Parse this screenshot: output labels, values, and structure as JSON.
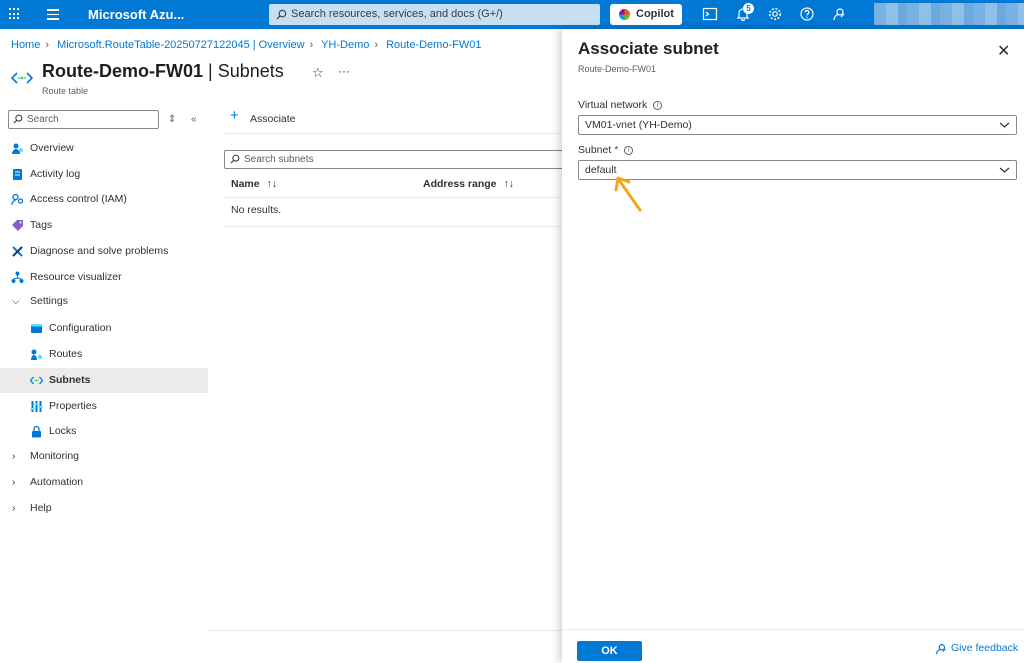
{
  "topbar": {
    "brand": "Microsoft Azu...",
    "search_placeholder": "Search resources, services, and docs (G+/)",
    "copilot_label": "Copilot",
    "notification_count": "5"
  },
  "breadcrumb": [
    "Home",
    "Microsoft.RouteTable-20250727122045 | Overview",
    "YH-Demo",
    "Route-Demo-FW01"
  ],
  "header": {
    "title": "Route-Demo-FW01",
    "section": "Subnets",
    "resource_type": "Route table"
  },
  "sidebar": {
    "search_placeholder": "Search",
    "items": [
      {
        "label": "Overview"
      },
      {
        "label": "Activity log"
      },
      {
        "label": "Access control (IAM)"
      },
      {
        "label": "Tags"
      },
      {
        "label": "Diagnose and solve problems"
      },
      {
        "label": "Resource visualizer"
      },
      {
        "label": "Settings"
      },
      {
        "label": "Configuration"
      },
      {
        "label": "Routes"
      },
      {
        "label": "Subnets"
      },
      {
        "label": "Properties"
      },
      {
        "label": "Locks"
      },
      {
        "label": "Monitoring"
      },
      {
        "label": "Automation"
      },
      {
        "label": "Help"
      }
    ]
  },
  "main": {
    "associate_label": "Associate",
    "search_placeholder": "Search subnets",
    "columns": [
      "Name",
      "Address range"
    ],
    "sort_glyph": "↑↓",
    "empty_text": "No results."
  },
  "panel": {
    "title": "Associate subnet",
    "subtitle": "Route-Demo-FW01",
    "vnet_label": "Virtual network",
    "vnet_value": "VM01-vnet (YH-Demo)",
    "subnet_label": "Subnet",
    "subnet_required": "*",
    "subnet_value": "default",
    "ok_label": "OK",
    "feedback_label": "Give feedback"
  },
  "colors": {
    "accent": "#0078d4",
    "annotation_arrow": "#f2a71b"
  }
}
